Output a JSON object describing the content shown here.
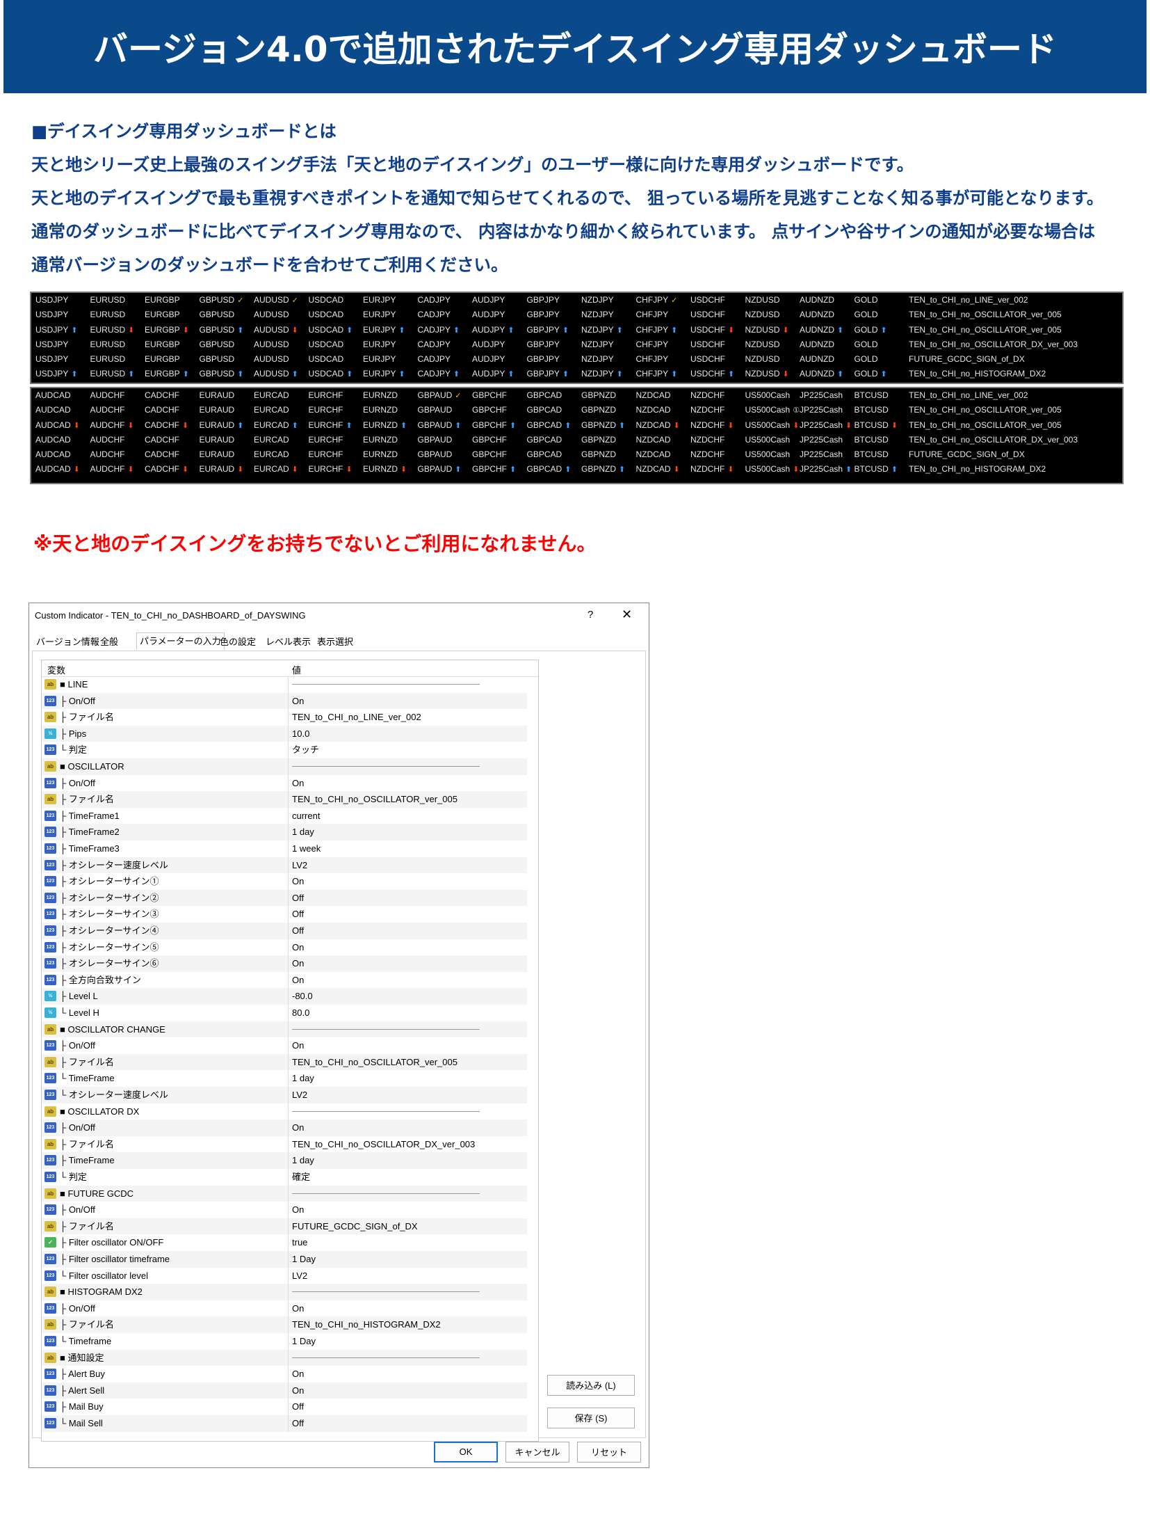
{
  "banner": {
    "title": "バージョン4.0で追加されたデイスイング専用ダッシュボード"
  },
  "intro": [
    "■デイスイング専用ダッシュボードとは",
    "天と地シリーズ史上最強のスイング手法「天と地のデイスイング」のユーザー様に向けた専用ダッシュボードです。",
    "天と地のデイスイングで最も重視すべきポイントを通知で知らせてくれるので、 狙っている場所を見逃すことなく知る事が可能となります。",
    "通常のダッシュボードに比べてデイスイング専用なので、 内容はかなり細かく絞られています。 点サインや谷サインの通知が必要な場合は",
    "通常バージョンのダッシュボードを合わせてご利用ください。"
  ],
  "dashboard1": {
    "symbols": [
      "USDJPY",
      "EURUSD",
      "EURGBP",
      "GBPUSD",
      "AUDUSD",
      "USDCAD",
      "EURJPY",
      "CADJPY",
      "AUDJPY",
      "GBPJPY",
      "NZDJPY",
      "CHFJPY",
      "USDCHF",
      "NZDUSD",
      "AUDNZD",
      "GOLD"
    ],
    "rows": [
      {
        "name": "TEN_to_CHI_no_LINE_ver_002",
        "marks": [
          "",
          "",
          "",
          "check",
          "check",
          "",
          "",
          "",
          "",
          "",
          "",
          "check",
          "",
          "",
          "",
          ""
        ]
      },
      {
        "name": "TEN_to_CHI_no_OSCILLATOR_ver_005",
        "marks": [
          "",
          "",
          "",
          "",
          "",
          "",
          "",
          "",
          "",
          "",
          "",
          "",
          "",
          "",
          "",
          ""
        ]
      },
      {
        "name": "TEN_to_CHI_no_OSCILLATOR_ver_005",
        "marks": [
          "up",
          "down",
          "down",
          "up",
          "down",
          "up",
          "up",
          "up",
          "up",
          "up",
          "up",
          "up",
          "down",
          "down",
          "up",
          "up"
        ]
      },
      {
        "name": "TEN_to_CHI_no_OSCILLATOR_DX_ver_003",
        "marks": [
          "",
          "",
          "",
          "",
          "",
          "",
          "",
          "",
          "",
          "",
          "",
          "",
          "",
          "",
          "",
          ""
        ]
      },
      {
        "name": "FUTURE_GCDC_SIGN_of_DX",
        "marks": [
          "",
          "",
          "",
          "",
          "",
          "",
          "",
          "",
          "",
          "",
          "",
          "",
          "",
          "",
          "",
          ""
        ]
      },
      {
        "name": "TEN_to_CHI_no_HISTOGRAM_DX2",
        "marks": [
          "up",
          "up",
          "up",
          "up",
          "up",
          "up",
          "up",
          "up",
          "up",
          "up",
          "up",
          "up",
          "up",
          "down",
          "up",
          "up"
        ]
      }
    ]
  },
  "dashboard2": {
    "symbols": [
      "AUDCAD",
      "AUDCHF",
      "CADCHF",
      "EURAUD",
      "EURCAD",
      "EURCHF",
      "EURNZD",
      "GBPAUD",
      "GBPCHF",
      "GBPCAD",
      "GBPNZD",
      "NZDCAD",
      "NZDCHF",
      "US500Cash",
      "JP225Cash",
      "BTCUSD"
    ],
    "rows": [
      {
        "name": "TEN_to_CHI_no_LINE_ver_002",
        "marks": [
          "",
          "",
          "",
          "",
          "",
          "",
          "",
          "check",
          "",
          "",
          "",
          "",
          "",
          "",
          "",
          ""
        ]
      },
      {
        "name": "TEN_to_CHI_no_OSCILLATOR_ver_005",
        "marks": [
          "",
          "",
          "",
          "",
          "",
          "",
          "",
          "",
          "",
          "",
          "",
          "",
          "",
          "circ",
          "",
          ""
        ]
      },
      {
        "name": "TEN_to_CHI_no_OSCILLATOR_ver_005",
        "marks": [
          "down",
          "down",
          "down",
          "up",
          "up",
          "up",
          "up",
          "up",
          "up",
          "up",
          "up",
          "down",
          "down",
          "down",
          "down",
          "down"
        ]
      },
      {
        "name": "TEN_to_CHI_no_OSCILLATOR_DX_ver_003",
        "marks": [
          "",
          "",
          "",
          "",
          "",
          "",
          "",
          "",
          "",
          "",
          "",
          "",
          "",
          "",
          "",
          ""
        ]
      },
      {
        "name": "FUTURE_GCDC_SIGN_of_DX",
        "marks": [
          "",
          "",
          "",
          "",
          "",
          "",
          "",
          "",
          "",
          "",
          "",
          "",
          "",
          "",
          "",
          ""
        ]
      },
      {
        "name": "TEN_to_CHI_no_HISTOGRAM_DX2",
        "marks": [
          "down",
          "down",
          "down",
          "down",
          "down",
          "down",
          "down",
          "up",
          "up",
          "up",
          "up",
          "down",
          "down",
          "down",
          "up",
          "up"
        ]
      }
    ]
  },
  "warning": "※天と地のデイスイングをお持ちでないとご利用になれません。",
  "dialog": {
    "title": "Custom Indicator - TEN_to_CHI_no_DASHBOARD_of_DAYSWING",
    "help": "?",
    "close": "✕",
    "tabs": [
      "バージョン情報",
      "全般",
      "パラメーターの入力",
      "色の設定",
      "レベル表示",
      "表示選択"
    ],
    "active_tab": 2,
    "col_var": "変数",
    "col_val": "値",
    "icons": {
      "ab": "ab",
      "n123": "123",
      "v12": "½",
      "bool": "✓"
    },
    "params": [
      {
        "icon": "ab",
        "name": "■ LINE",
        "value": "",
        "sep": true
      },
      {
        "icon": "n123",
        "name": "├ On/Off",
        "value": "On"
      },
      {
        "icon": "ab",
        "name": "├ ファイル名",
        "value": "TEN_to_CHI_no_LINE_ver_002"
      },
      {
        "icon": "v12",
        "name": "├ Pips",
        "value": "10.0"
      },
      {
        "icon": "n123",
        "name": "└ 判定",
        "value": "タッチ"
      },
      {
        "icon": "ab",
        "name": "■ OSCILLATOR",
        "value": "",
        "sep": true
      },
      {
        "icon": "n123",
        "name": "├ On/Off",
        "value": "On"
      },
      {
        "icon": "ab",
        "name": "├ ファイル名",
        "value": "TEN_to_CHI_no_OSCILLATOR_ver_005"
      },
      {
        "icon": "n123",
        "name": "├ TimeFrame1",
        "value": "current"
      },
      {
        "icon": "n123",
        "name": "├ TimeFrame2",
        "value": "1 day"
      },
      {
        "icon": "n123",
        "name": "├ TimeFrame3",
        "value": "1 week"
      },
      {
        "icon": "n123",
        "name": "├ オシレーター速度レベル",
        "value": "LV2"
      },
      {
        "icon": "n123",
        "name": "├ オシレーターサイン①",
        "value": "On"
      },
      {
        "icon": "n123",
        "name": "├ オシレーターサイン②",
        "value": "Off"
      },
      {
        "icon": "n123",
        "name": "├ オシレーターサイン③",
        "value": "Off"
      },
      {
        "icon": "n123",
        "name": "├ オシレーターサイン④",
        "value": "Off"
      },
      {
        "icon": "n123",
        "name": "├ オシレーターサイン⑤",
        "value": "On"
      },
      {
        "icon": "n123",
        "name": "├ オシレーターサイン⑥",
        "value": "On"
      },
      {
        "icon": "n123",
        "name": "├ 全方向合致サイン",
        "value": "On"
      },
      {
        "icon": "v12",
        "name": "├ Level L",
        "value": "-80.0"
      },
      {
        "icon": "v12",
        "name": "└ Level H",
        "value": "80.0"
      },
      {
        "icon": "ab",
        "name": "■ OSCILLATOR CHANGE",
        "value": "",
        "sep": true
      },
      {
        "icon": "n123",
        "name": "├ On/Off",
        "value": "On"
      },
      {
        "icon": "ab",
        "name": "├ ファイル名",
        "value": "TEN_to_CHI_no_OSCILLATOR_ver_005"
      },
      {
        "icon": "n123",
        "name": "└ TimeFrame",
        "value": "1 day"
      },
      {
        "icon": "n123",
        "name": "└ オシレーター速度レベル",
        "value": "LV2"
      },
      {
        "icon": "ab",
        "name": "■ OSCILLATOR DX",
        "value": "",
        "sep": true
      },
      {
        "icon": "n123",
        "name": "├ On/Off",
        "value": "On"
      },
      {
        "icon": "ab",
        "name": "├ ファイル名",
        "value": "TEN_to_CHI_no_OSCILLATOR_DX_ver_003"
      },
      {
        "icon": "n123",
        "name": "├ TimeFrame",
        "value": "1 day"
      },
      {
        "icon": "n123",
        "name": "└ 判定",
        "value": "確定"
      },
      {
        "icon": "ab",
        "name": "■ FUTURE GCDC",
        "value": "",
        "sep": true
      },
      {
        "icon": "n123",
        "name": "├ On/Off",
        "value": "On"
      },
      {
        "icon": "ab",
        "name": "├ ファイル名",
        "value": "FUTURE_GCDC_SIGN_of_DX"
      },
      {
        "icon": "bool",
        "name": "├ Filter oscillator ON/OFF",
        "value": "true"
      },
      {
        "icon": "n123",
        "name": "├ Filter oscillator timeframe",
        "value": "1 Day"
      },
      {
        "icon": "n123",
        "name": "└ Filter oscillator level",
        "value": "LV2"
      },
      {
        "icon": "ab",
        "name": "■ HISTOGRAM DX2",
        "value": "",
        "sep": true
      },
      {
        "icon": "n123",
        "name": "├ On/Off",
        "value": "On"
      },
      {
        "icon": "ab",
        "name": "├ ファイル名",
        "value": "TEN_to_CHI_no_HISTOGRAM_DX2"
      },
      {
        "icon": "n123",
        "name": "└ Timeframe",
        "value": "1 Day"
      },
      {
        "icon": "ab",
        "name": "■ 通知設定",
        "value": "",
        "sep": true
      },
      {
        "icon": "n123",
        "name": "├ Alert Buy",
        "value": "On"
      },
      {
        "icon": "n123",
        "name": "├ Alert Sell",
        "value": "On"
      },
      {
        "icon": "n123",
        "name": "├ Mail Buy",
        "value": "Off"
      },
      {
        "icon": "n123",
        "name": "└ Mail Sell",
        "value": "Off"
      }
    ],
    "buttons": {
      "load": "読み込み (L)",
      "save": "保存 (S)",
      "ok": "OK",
      "cancel": "キャンセル",
      "reset": "リセット"
    }
  }
}
